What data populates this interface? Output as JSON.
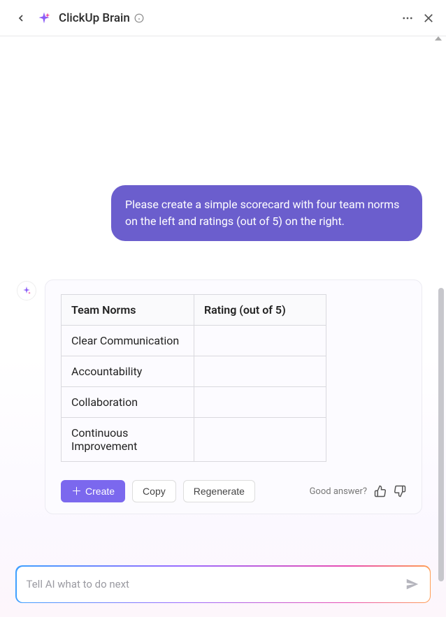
{
  "header": {
    "title": "ClickUp Brain"
  },
  "conversation": {
    "user_message": "Please create a simple scorecard with four team norms on the left and ratings (out of 5) on the right.",
    "table": {
      "col1": "Team Norms",
      "col2": "Rating (out of 5)",
      "rows": [
        {
          "norm": "Clear Communication",
          "rating": ""
        },
        {
          "norm": "Accountability",
          "rating": ""
        },
        {
          "norm": "Collaboration",
          "rating": ""
        },
        {
          "norm": "Continuous Improvement",
          "rating": ""
        }
      ]
    }
  },
  "actions": {
    "create": "Create",
    "copy": "Copy",
    "regenerate": "Regenerate",
    "feedback_label": "Good answer?"
  },
  "input": {
    "placeholder": "Tell AI what to do next"
  }
}
